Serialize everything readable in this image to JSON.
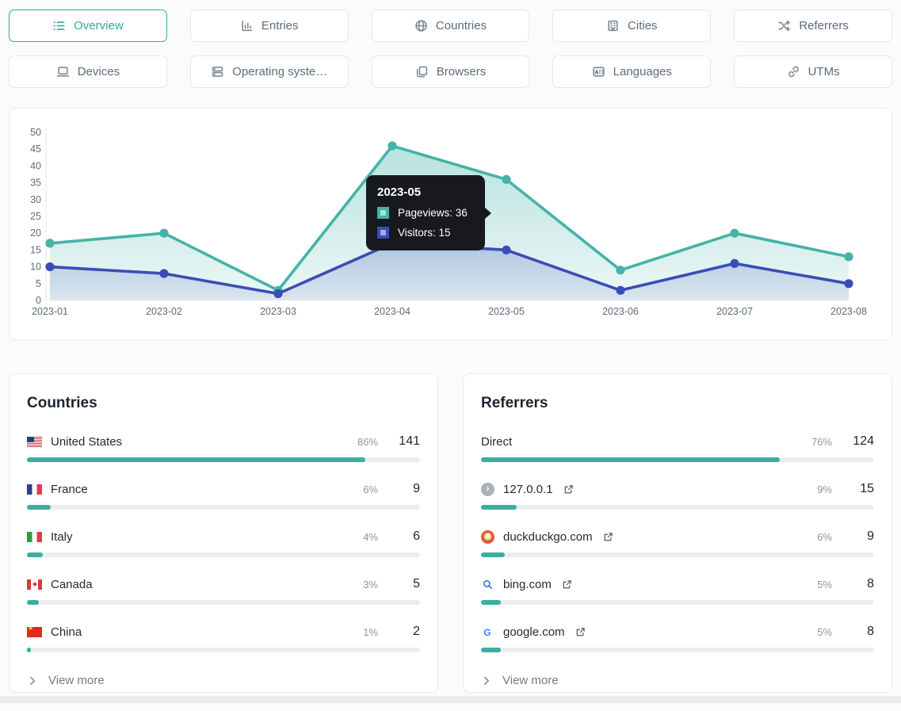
{
  "colors": {
    "accent_teal": "#35a99e",
    "series_teal": "#45b3a7",
    "series_indigo": "#3a4db6",
    "bar_fill": "#3aaea2"
  },
  "tabs": [
    {
      "id": "overview",
      "label": "Overview",
      "icon": "list",
      "active": true
    },
    {
      "id": "entries",
      "label": "Entries",
      "icon": "chart",
      "active": false
    },
    {
      "id": "countries",
      "label": "Countries",
      "icon": "globe",
      "active": false
    },
    {
      "id": "cities",
      "label": "Cities",
      "icon": "building",
      "active": false
    },
    {
      "id": "referrers",
      "label": "Referrers",
      "icon": "shuffle",
      "active": false
    },
    {
      "id": "devices",
      "label": "Devices",
      "icon": "laptop",
      "active": false
    },
    {
      "id": "operating-systems",
      "label": "Operating syste…",
      "icon": "server",
      "active": false
    },
    {
      "id": "browsers",
      "label": "Browsers",
      "icon": "pages",
      "active": false
    },
    {
      "id": "languages",
      "label": "Languages",
      "icon": "translate",
      "active": false
    },
    {
      "id": "utms",
      "label": "UTMs",
      "icon": "link",
      "active": false
    }
  ],
  "chart_data": {
    "type": "line",
    "x": [
      "2023-01",
      "2023-02",
      "2023-03",
      "2023-04",
      "2023-05",
      "2023-06",
      "2023-07",
      "2023-08"
    ],
    "series": [
      {
        "name": "Pageviews",
        "color": "#45b3a7",
        "values": [
          17,
          20,
          3,
          46,
          36,
          9,
          20,
          13
        ]
      },
      {
        "name": "Visitors",
        "color": "#3a4db6",
        "values": [
          10,
          8,
          2,
          17,
          15,
          3,
          11,
          5
        ]
      }
    ],
    "ylim": [
      0,
      50
    ],
    "ytick_step": 5,
    "grid": false,
    "legend_position": "tooltip-only",
    "tooltip": {
      "title": "2023-05",
      "anchor_index": 4,
      "rows": [
        {
          "series": "Pageviews",
          "value": 36
        },
        {
          "series": "Visitors",
          "value": 15
        }
      ]
    }
  },
  "cards": [
    {
      "id": "countries",
      "title": "Countries",
      "view_more": "View more",
      "rows": [
        {
          "icon": "flag-us",
          "name": "United States",
          "percent": "86%",
          "value": "141",
          "bar_pct": 86,
          "external": false
        },
        {
          "icon": "flag-fr",
          "name": "France",
          "percent": "6%",
          "value": "9",
          "bar_pct": 6,
          "external": false
        },
        {
          "icon": "flag-it",
          "name": "Italy",
          "percent": "4%",
          "value": "6",
          "bar_pct": 4,
          "external": false
        },
        {
          "icon": "flag-ca",
          "name": "Canada",
          "percent": "3%",
          "value": "5",
          "bar_pct": 3,
          "external": false
        },
        {
          "icon": "flag-cn",
          "name": "China",
          "percent": "1%",
          "value": "2",
          "bar_pct": 1,
          "external": false
        }
      ]
    },
    {
      "id": "referrers",
      "title": "Referrers",
      "view_more": "View more",
      "rows": [
        {
          "icon": null,
          "name": "Direct",
          "percent": "76%",
          "value": "124",
          "bar_pct": 76,
          "external": false
        },
        {
          "icon": "favicon-default",
          "name": "127.0.0.1",
          "percent": "9%",
          "value": "15",
          "bar_pct": 9,
          "external": true
        },
        {
          "icon": "favicon-ddg",
          "name": "duckduckgo.com",
          "percent": "6%",
          "value": "9",
          "bar_pct": 6,
          "external": true
        },
        {
          "icon": "favicon-bing",
          "name": "bing.com",
          "percent": "5%",
          "value": "8",
          "bar_pct": 5,
          "external": true
        },
        {
          "icon": "favicon-google",
          "name": "google.com",
          "percent": "5%",
          "value": "8",
          "bar_pct": 5,
          "external": true
        }
      ]
    }
  ]
}
